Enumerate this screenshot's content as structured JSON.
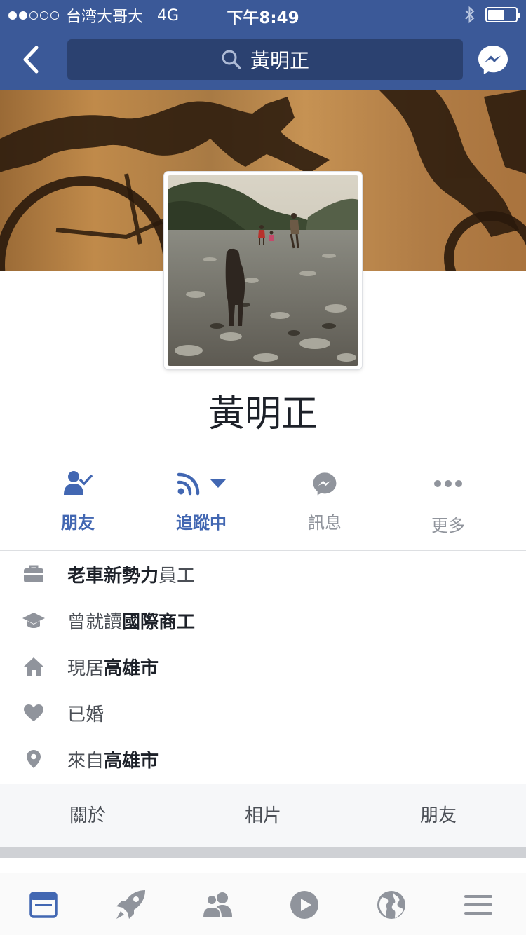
{
  "status_bar": {
    "carrier": "台湾大哥大",
    "network": "4G",
    "time": "下午8:49",
    "signal_bars_filled": 2,
    "signal_bars_total": 5,
    "battery_level": 0.6
  },
  "nav": {
    "search_query": "黃明正"
  },
  "profile": {
    "name": "黃明正"
  },
  "actions": [
    {
      "label": "朋友",
      "icon": "friend-check-icon",
      "state": "active"
    },
    {
      "label": "追蹤中",
      "icon": "rss-follow-icon",
      "state": "active"
    },
    {
      "label": "訊息",
      "icon": "messenger-icon",
      "state": "inactive"
    },
    {
      "label": "更多",
      "icon": "more-dots-icon",
      "state": "inactive"
    }
  ],
  "info": [
    {
      "icon": "briefcase-icon",
      "prefix": "",
      "bold": "老車新勢力",
      "suffix": "員工"
    },
    {
      "icon": "graduation-cap-icon",
      "prefix": "曾就讀",
      "bold": "國際商工",
      "suffix": ""
    },
    {
      "icon": "home-icon",
      "prefix": "現居",
      "bold": "高雄市",
      "suffix": ""
    },
    {
      "icon": "heart-icon",
      "prefix": "已婚",
      "bold": "",
      "suffix": ""
    },
    {
      "icon": "location-pin-icon",
      "prefix": "來自",
      "bold": "高雄市",
      "suffix": ""
    }
  ],
  "tabs": [
    {
      "label": "關於"
    },
    {
      "label": "相片"
    },
    {
      "label": "朋友"
    }
  ],
  "bottom_nav": [
    {
      "icon": "news-feed-icon",
      "active": true
    },
    {
      "icon": "rocket-icon",
      "active": false
    },
    {
      "icon": "friends-icon",
      "active": false
    },
    {
      "icon": "video-play-icon",
      "active": false
    },
    {
      "icon": "globe-icon",
      "active": false
    },
    {
      "icon": "menu-icon",
      "active": false
    }
  ],
  "colors": {
    "brand_blue": "#3b5998",
    "search_bg": "#2b4170",
    "action_blue": "#4267b2",
    "grey_icon": "#90949c",
    "text_dark": "#1d2129"
  }
}
